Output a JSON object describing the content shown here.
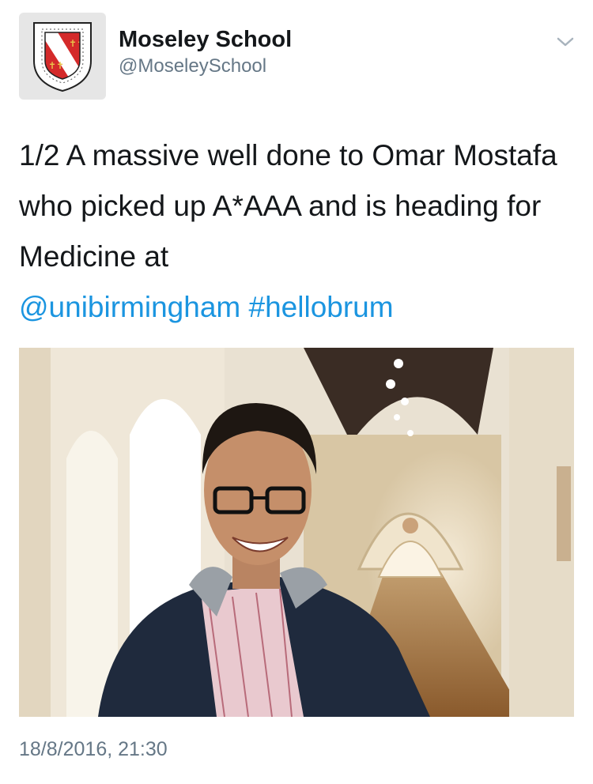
{
  "author": {
    "display_name": "Moseley School",
    "handle": "@MoseleySchool",
    "avatar_icon": "school-crest-icon",
    "menu_icon": "chevron-down-icon"
  },
  "tweet": {
    "text_main": "1/2 A massive well done to Omar Mostafa who picked up A*AAA and is heading for Medicine at",
    "mention": "@unibirmingham",
    "hashtag": "#hellobrum"
  },
  "media": {
    "type": "photo"
  },
  "meta": {
    "timestamp": "18/8/2016, 21:30"
  },
  "colors": {
    "link": "#1b95e0",
    "secondary_text": "#657786",
    "primary_text": "#14171a",
    "crest_red": "#d42a2a"
  }
}
